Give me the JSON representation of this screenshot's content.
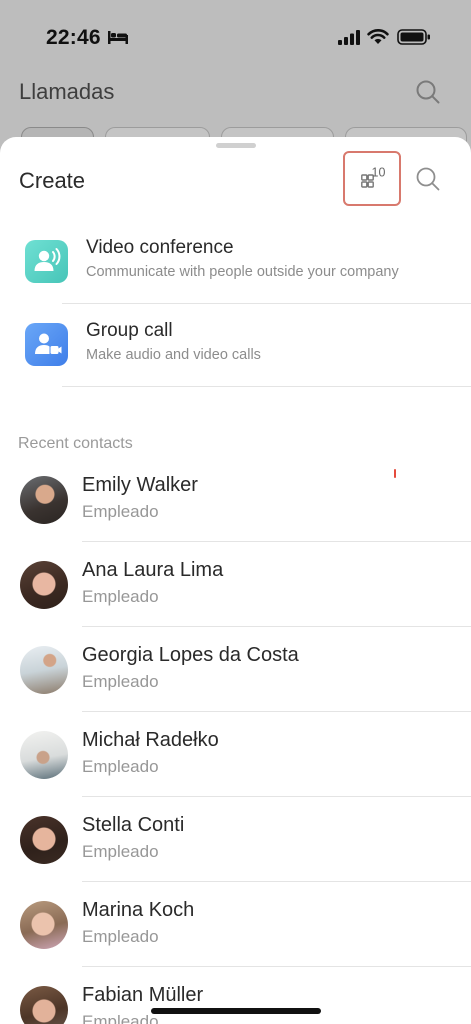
{
  "status_bar": {
    "time": "22:46",
    "icons": [
      "bed-icon",
      "signal-icon",
      "wifi-icon",
      "battery-icon"
    ]
  },
  "background_page": {
    "title": "Llamadas",
    "icons": [
      "search-icon"
    ]
  },
  "sheet": {
    "title": "Create",
    "qr_label": "10",
    "icons": [
      "qr-code-icon",
      "search-icon"
    ],
    "options": [
      {
        "title": "Video conference",
        "subtitle": "Communicate with people outside your company",
        "icon": "video-conference-icon",
        "color": "#5ed3c7"
      },
      {
        "title": "Group call",
        "subtitle": "Make audio and video calls",
        "icon": "group-call-icon",
        "color": "#4f8ef2"
      }
    ],
    "recent_label": "Recent contacts",
    "contacts": [
      {
        "name": "Emily Walker",
        "role": "Empleado"
      },
      {
        "name": "Ana Laura Lima",
        "role": "Empleado"
      },
      {
        "name": "Georgia Lopes da Costa",
        "role": "Empleado"
      },
      {
        "name": "Michał Radełko",
        "role": "Empleado"
      },
      {
        "name": "Stella Conti",
        "role": "Empleado"
      },
      {
        "name": "Marina Koch",
        "role": "Empleado"
      },
      {
        "name": "Fabian Müller",
        "role": "Empleado"
      }
    ]
  },
  "colors": {
    "overlay": "#bdbdbd",
    "qr_highlight": "#d8796d",
    "accent_red": "#e54b3c"
  }
}
